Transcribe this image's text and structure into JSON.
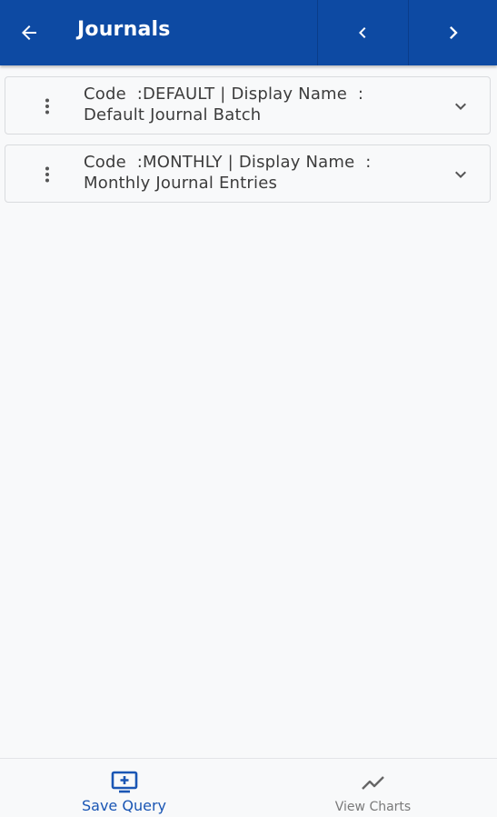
{
  "header": {
    "title": "Journals",
    "back_icon": "arrow-left-icon",
    "prev_icon": "chevron-left-icon",
    "next_icon": "chevron-right-icon",
    "background": "#0d4aa3"
  },
  "journals": [
    {
      "code_label": "Code",
      "code_value": "DEFAULT",
      "display_label": "Display Name",
      "display_value": "Default Journal Batch"
    },
    {
      "code_label": "Code",
      "code_value": "MONTHLY",
      "display_label": "Display Name",
      "display_value": "Monthly Journal Entries"
    }
  ],
  "bottom_bar": {
    "save_query": {
      "label": "Save Query",
      "icon": "add-to-screen-icon",
      "color": "#1a56b4"
    },
    "view_charts": {
      "label": "View Charts",
      "icon": "trend-line-icon",
      "color": "#7a7a7a"
    }
  }
}
